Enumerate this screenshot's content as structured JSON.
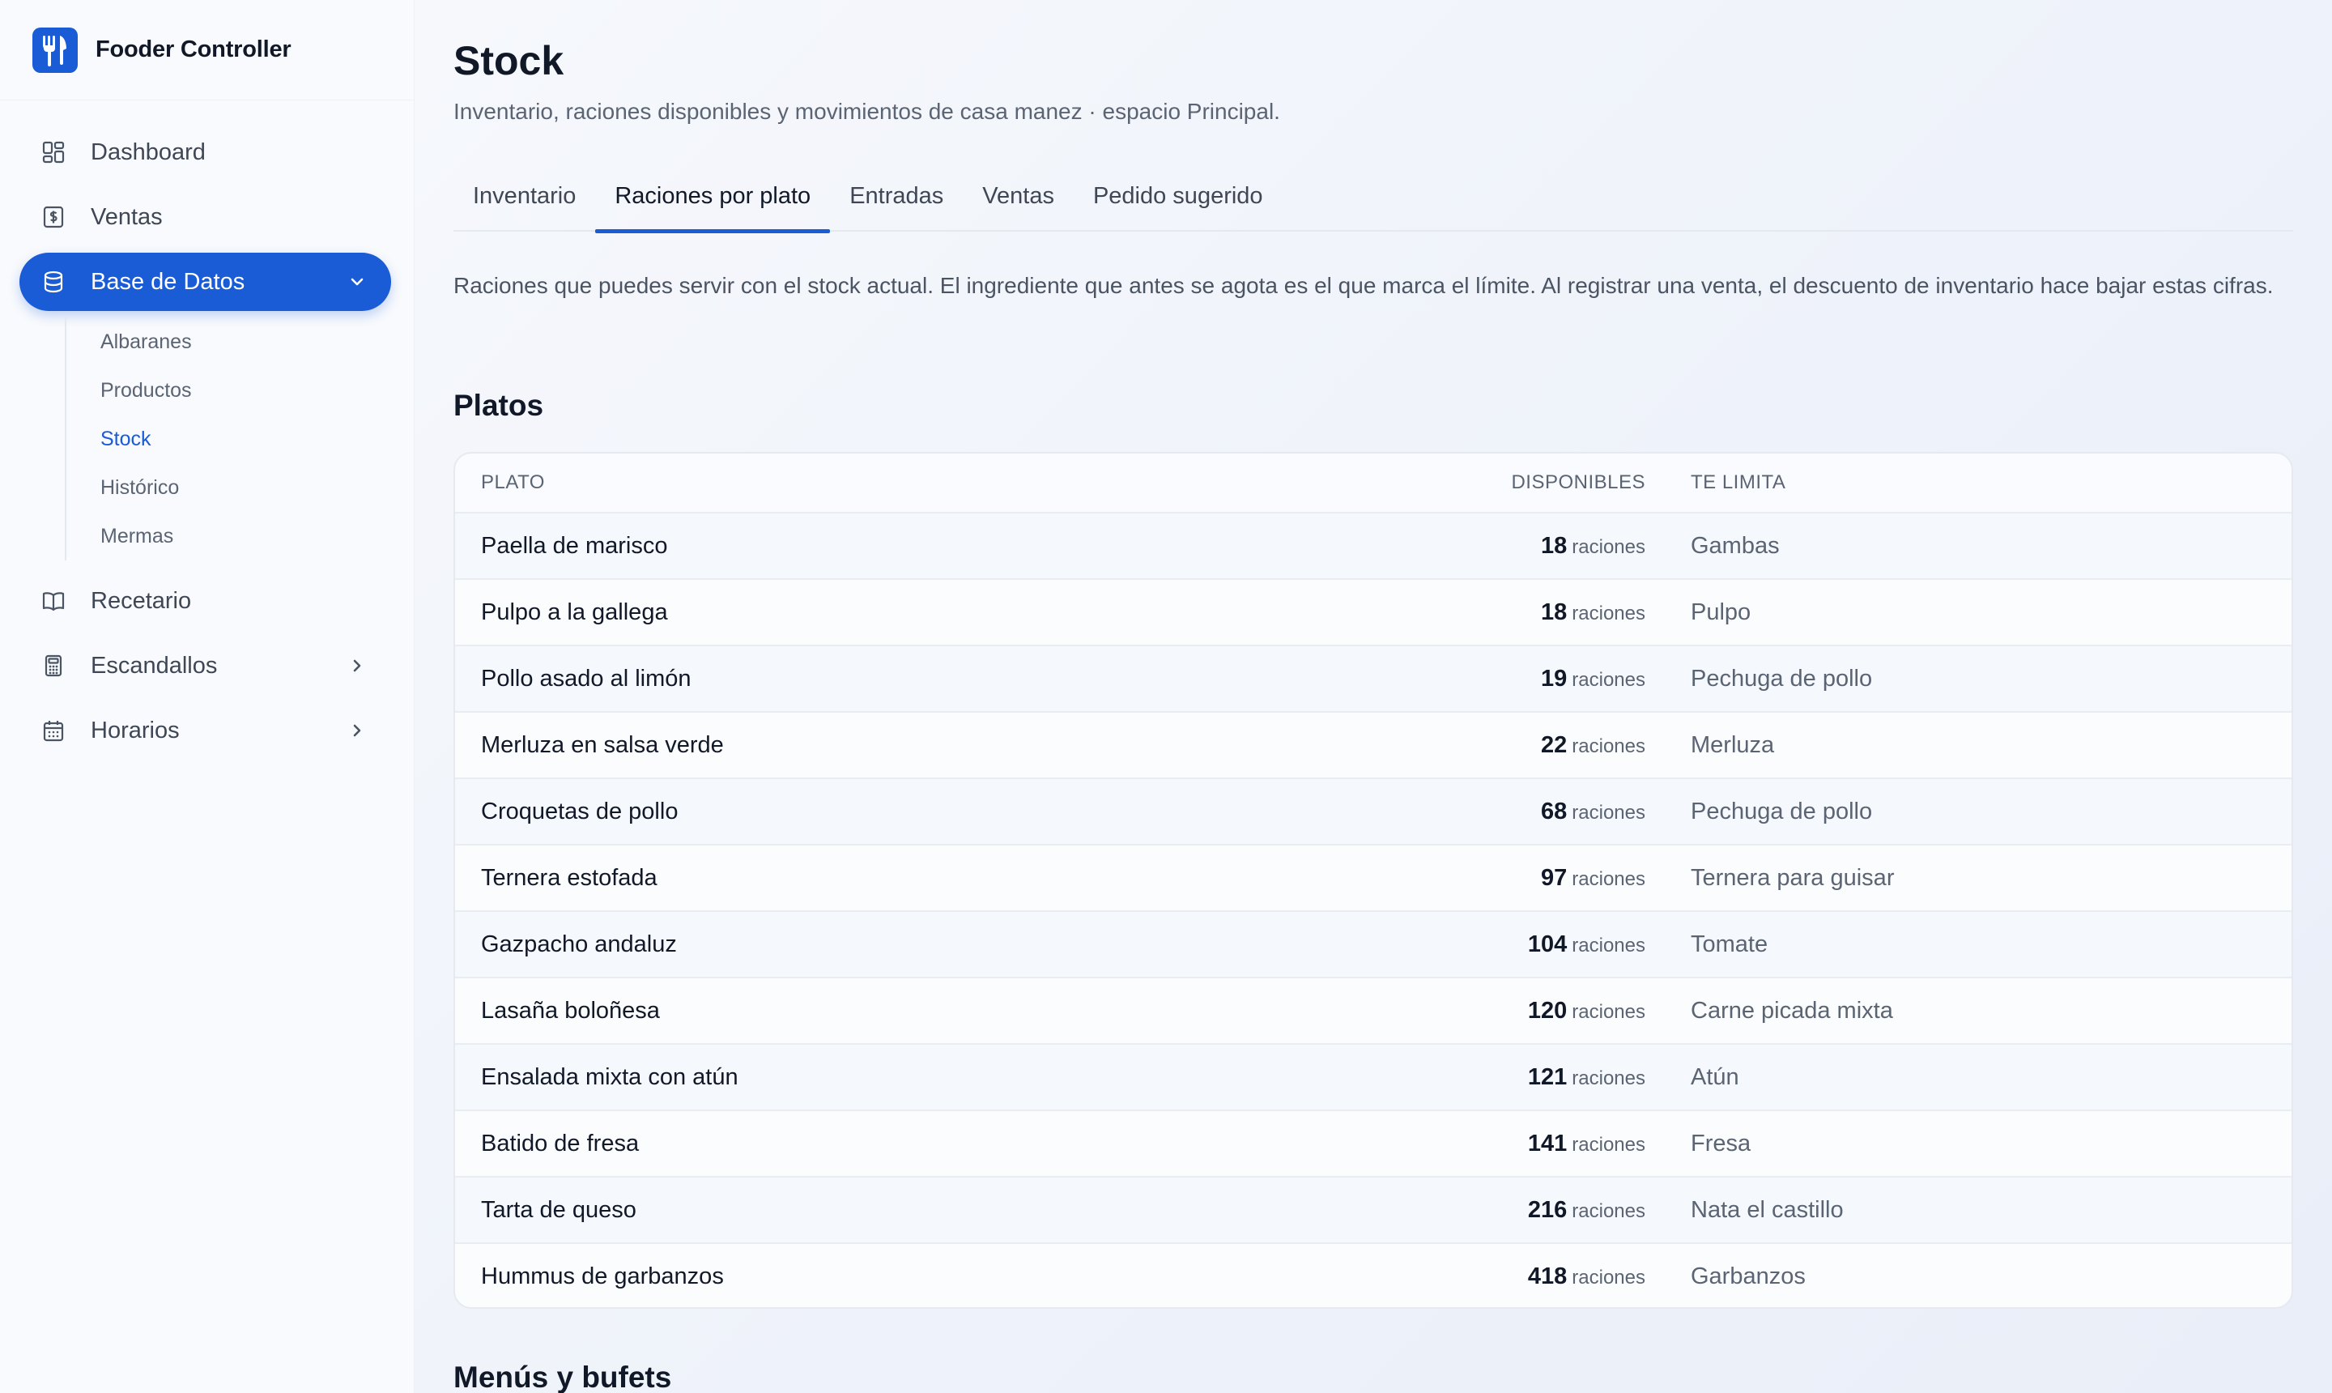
{
  "app": {
    "name": "Fooder Controller"
  },
  "sidebar": {
    "items": [
      {
        "label": "Dashboard",
        "icon": "dashboard-icon"
      },
      {
        "label": "Ventas",
        "icon": "dollar-icon"
      },
      {
        "label": "Base de Datos",
        "icon": "database-icon",
        "active": true,
        "expanded": true
      },
      {
        "label": "Recetario",
        "icon": "book-icon"
      },
      {
        "label": "Escandallos",
        "icon": "calculator-icon"
      },
      {
        "label": "Horarios",
        "icon": "calendar-icon"
      }
    ],
    "sub_items": [
      "Albaranes",
      "Productos",
      "Stock",
      "Histórico",
      "Mermas"
    ],
    "active_sub": "Stock"
  },
  "page": {
    "title": "Stock",
    "subtitle": "Inventario, raciones disponibles y movimientos de casa manez · espacio Principal."
  },
  "tabs": [
    "Inventario",
    "Raciones por plato",
    "Entradas",
    "Ventas",
    "Pedido sugerido"
  ],
  "active_tab": "Raciones por plato",
  "description": "Raciones que puedes servir con el stock actual. El ingrediente que antes se agota es el que marca el límite. Al registrar una venta, el descuento de inventario hace bajar estas cifras.",
  "platos": {
    "title": "Platos",
    "columns": {
      "plato": "PLATO",
      "disponibles": "DISPONIBLES",
      "limita": "TE LIMITA"
    },
    "unit": "raciones",
    "rows": [
      {
        "plato": "Paella de marisco",
        "disponibles": "18",
        "limita": "Gambas"
      },
      {
        "plato": "Pulpo a la gallega",
        "disponibles": "18",
        "limita": "Pulpo"
      },
      {
        "plato": "Pollo asado al limón",
        "disponibles": "19",
        "limita": "Pechuga de pollo"
      },
      {
        "plato": "Merluza en salsa verde",
        "disponibles": "22",
        "limita": "Merluza"
      },
      {
        "plato": "Croquetas de pollo",
        "disponibles": "68",
        "limita": "Pechuga de pollo"
      },
      {
        "plato": "Ternera estofada",
        "disponibles": "97",
        "limita": "Ternera para guisar"
      },
      {
        "plato": "Gazpacho andaluz",
        "disponibles": "104",
        "limita": "Tomate"
      },
      {
        "plato": "Lasaña boloñesa",
        "disponibles": "120",
        "limita": "Carne picada mixta"
      },
      {
        "plato": "Ensalada mixta con atún",
        "disponibles": "121",
        "limita": "Atún"
      },
      {
        "plato": "Batido de fresa",
        "disponibles": "141",
        "limita": "Fresa"
      },
      {
        "plato": "Tarta de queso",
        "disponibles": "216",
        "limita": "Nata el castillo"
      },
      {
        "plato": "Hummus de garbanzos",
        "disponibles": "418",
        "limita": "Garbanzos"
      }
    ]
  },
  "menus": {
    "title": "Menús y bufets"
  },
  "colors": {
    "accent": "#1a5bd6",
    "text": "#111827",
    "muted": "#5b6473"
  }
}
